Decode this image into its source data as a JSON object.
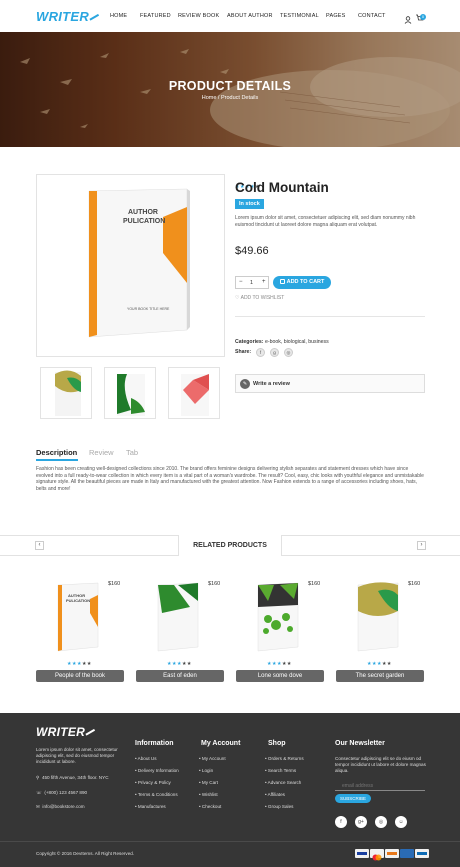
{
  "brand": {
    "logo": "WRITER"
  },
  "nav": {
    "items": [
      "HOME",
      "FEATURED",
      "REVIEW BOOK",
      "ABOUT AUTHOR",
      "TESTIMONIAL",
      "PAGES",
      "CONTACT"
    ],
    "cart_count": "0"
  },
  "hero": {
    "title": "PRODUCT DETAILS",
    "breadcrumb": "Home / Product Details"
  },
  "product": {
    "cover_author_line1": "AUTHOR",
    "cover_author_line2": "PULICATION",
    "cover_subtitle": "YOUR BOOK TITLE HERE",
    "rating": 4,
    "rating_max": 5,
    "title": "Cold Mountain",
    "stock": "In stock",
    "description": "Lorem ipsum dolor sit amet, consectetuer adipiscing elit, sed diam nonummy nibh euismod tincidunt ut laoreet dolore magna aliquam erat volutpat.",
    "price": "$49.66",
    "quantity": "1",
    "add_to_cart": "ADD TO CART",
    "wishlist": "ADD TO WISHLIST",
    "categories_label": "Categories:",
    "categories": "e-book, biological, business",
    "share_label": "Share:",
    "write_review": "Write a review"
  },
  "tabs": {
    "items": [
      "Description",
      "Review",
      "Tab"
    ],
    "active": "Description",
    "content": "Fashion has been creating well-designed collections since 2010. The brand offers feminine designs delivering stylish separates and statement dresses which have since evolved into a full ready-to-wear collection in which every item is a vital part of a woman's wardrobe. The result? Cool, easy, chic looks with youthful elegance and unmistakable signature style. All the beautiful pieces are made in Italy and manufactured with the greatest attention. Now Fashion extends to a range of accessories including shoes, hats, belts and more!"
  },
  "related": {
    "heading": "RELATED PRODUCTS",
    "items": [
      {
        "name": "People of the book",
        "price": "$160",
        "rating": 4
      },
      {
        "name": "East of eden",
        "price": "$160",
        "rating": 4
      },
      {
        "name": "Lone some dove",
        "price": "$160",
        "rating": 4
      },
      {
        "name": "The secret garden",
        "price": "$160",
        "rating": 4
      }
    ]
  },
  "footer": {
    "logo": "WRITER",
    "about": "Lorem ipsum dolor sit amet, consectetur adipiscing elit, sed do eiusmod tempor incididunt ut labore.",
    "address": "450 fifth Avenue, 34th floor. NYC",
    "phone": "(+800) 123 4567 890",
    "email": "info@bookstore.com",
    "information": {
      "title": "Information",
      "links": [
        "About Us",
        "Delivery Information",
        "Privacy & Policy",
        "Terms & Conditions",
        "Manufactures"
      ]
    },
    "account": {
      "title": "My Account",
      "links": [
        "My Account",
        "Login",
        "My Cart",
        "Wishlist",
        "Checkout"
      ]
    },
    "shop": {
      "title": "Shop",
      "links": [
        "Orders & Returns",
        "Search Terms",
        "Advance Search",
        "Affiliates",
        "Group Sales"
      ]
    },
    "newsletter": {
      "title": "Our Newsletter",
      "text": "Consectetur adipiscing elit se do eiusm od tempor incididunt ut labore et dolore magnas aliqua.",
      "placeholder": "email address",
      "button": "SUBSCRIBE"
    },
    "copyright": "Copyright © 2016 DevItems. All Right Reserved."
  },
  "colors": {
    "accent": "#2aa6e0",
    "orange": "#f0901c",
    "green": "#2e8b2e",
    "dark_footer": "#363636"
  },
  "icons": [
    "user-icon",
    "cart-icon",
    "chevron-left-icon",
    "chevron-right-icon",
    "pencil-icon",
    "heart-icon",
    "location-icon",
    "phone-icon",
    "mail-icon",
    "facebook-icon",
    "google-plus-icon",
    "instagram-icon"
  ]
}
